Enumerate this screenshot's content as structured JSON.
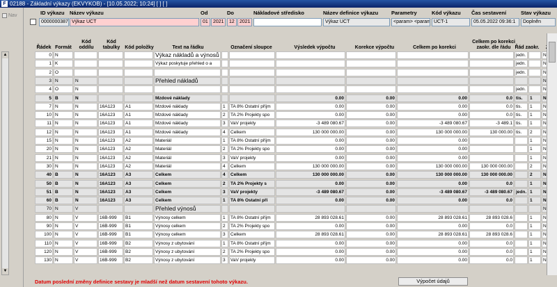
{
  "window": {
    "title": "02188 - Základní výkazy (EKVYKOB) - [10.05.2022; 10:24]  [ ]  [ ]"
  },
  "sidebar": {
    "nav_label": "Nav"
  },
  "header": {
    "labels": {
      "id": "ID výkazu",
      "name": "Název výkazu",
      "from": "Od",
      "to": "Do",
      "cost_center": "Nákladové středisko",
      "definition": "Název definice výkazu",
      "params": "Parametry",
      "code": "Kód výkazu",
      "created": "Čas sestavení",
      "state": "Stav výkazu"
    },
    "values": {
      "id": "0000000387",
      "name": "Výkaz UCT",
      "from_month": "01",
      "from_year": "2021",
      "to_month": "12",
      "to_year": "2021",
      "cost_center": "",
      "definition": "Výkaz UCT",
      "params": "<param>  <param",
      "code": "UCT-1",
      "created": "05.05.2022 09:36:1",
      "state": "Doplněn"
    }
  },
  "columns": {
    "row": "Řádek",
    "format": "Formát",
    "section": "Kód oddílu",
    "table": "Kód tabulky",
    "item": "Kód položky",
    "text": "Text na řádku",
    "col": "Označení sloupce",
    "result": "Výsledek výpočtu",
    "correction": "Korekce výpočtu",
    "total": "Celkem po korekci",
    "rounded": "Celkem po korekci zaokr. dle řádu",
    "order": "Řád zaokr.",
    "z": "Z"
  },
  "rows": [
    {
      "r": "0",
      "f": "N",
      "s": "",
      "t": "",
      "p": "",
      "text": "Výkaz nákladů a výnosů",
      "n": "",
      "col": "",
      "res": "",
      "cor": "",
      "tot": "",
      "rnd": "",
      "ord": "jedn.",
      "oz": "",
      "z": "N",
      "big": true
    },
    {
      "r": "1",
      "f": "K",
      "s": "",
      "t": "",
      "p": "",
      "text": "Výkaz poskytuje přehled o a",
      "n": "",
      "col": "",
      "res": "",
      "cor": "",
      "tot": "",
      "rnd": "",
      "ord": "jedn.",
      "oz": "",
      "z": "N"
    },
    {
      "r": "2",
      "f": "O",
      "s": "",
      "t": "",
      "p": "",
      "text": "",
      "n": "",
      "col": "",
      "res": "",
      "cor": "",
      "tot": "",
      "rnd": "",
      "ord": "jedn.",
      "oz": "",
      "z": "N"
    },
    {
      "r": "3",
      "f": "N",
      "s": "N",
      "t": "",
      "p": "",
      "text": "Přehled nákladů",
      "n": "",
      "col": "",
      "res": "",
      "cor": "",
      "tot": "",
      "rnd": "",
      "ord": "",
      "oz": "",
      "z": "N",
      "big": true,
      "gray": true
    },
    {
      "r": "4",
      "f": "O",
      "s": "N",
      "t": "",
      "p": "",
      "text": "",
      "n": "",
      "col": "",
      "res": "",
      "cor": "",
      "tot": "",
      "rnd": "",
      "ord": "jedn.",
      "oz": "",
      "z": "N"
    },
    {
      "r": "5",
      "f": "B",
      "s": "N",
      "t": "",
      "p": "",
      "text": "Mzdové náklady",
      "n": "",
      "col": "",
      "res": "0.00",
      "cor": "0.00",
      "tot": "0.00",
      "rnd": "0.0",
      "ord": "tis.",
      "oz": "1",
      "z": "N",
      "bold": true,
      "gray": true
    },
    {
      "r": "7",
      "f": "N",
      "s": "N",
      "t": "16A123",
      "p": "A1",
      "text": "Mzdové náklady",
      "n": "1",
      "col": "TA 8% Ostatní příjm",
      "res": "0.00",
      "cor": "0.00",
      "tot": "0.00",
      "rnd": "0.0",
      "ord": "tis.",
      "oz": "1",
      "z": "N"
    },
    {
      "r": "10",
      "f": "N",
      "s": "N",
      "t": "16A123",
      "p": "A1",
      "text": "Mzdové náklady",
      "n": "2",
      "col": "TA 2% Projekty spo",
      "res": "0.00",
      "cor": "0.00",
      "tot": "0.00",
      "rnd": "0.0",
      "ord": "tis.",
      "oz": "1",
      "z": "N"
    },
    {
      "r": "11",
      "f": "N",
      "s": "N",
      "t": "16A123",
      "p": "A1",
      "text": "Mzdové náklady",
      "n": "3",
      "col": "VaV projekty",
      "res": "-3 489 080.67",
      "cor": "0.00",
      "tot": "-3 489 080.67",
      "rnd": "-3 489.1",
      "ord": "tis.",
      "oz": "1",
      "z": "N"
    },
    {
      "r": "12",
      "f": "N",
      "s": "N",
      "t": "16A123",
      "p": "A1",
      "text": "Mzdové náklady",
      "n": "4",
      "col": "Celkem",
      "res": "130 000 000.00",
      "cor": "0.00",
      "tot": "130 000 000.00",
      "rnd": "130 000.00",
      "ord": "tis.",
      "oz": "2",
      "z": "N"
    },
    {
      "r": "15",
      "f": "N",
      "s": "N",
      "t": "16A123",
      "p": "A2",
      "text": "Materiál",
      "n": "1",
      "col": "TA 8% Ostatní příjm",
      "res": "0.00",
      "cor": "0.00",
      "tot": "0.00",
      "rnd": "",
      "ord": "",
      "oz": "1",
      "z": "N"
    },
    {
      "r": "20",
      "f": "N",
      "s": "N",
      "t": "16A123",
      "p": "A2",
      "text": "Materiál",
      "n": "2",
      "col": "TA 2% Projekty spo",
      "res": "0.00",
      "cor": "0.00",
      "tot": "0.00",
      "rnd": "",
      "ord": "",
      "oz": "1",
      "z": "N"
    },
    {
      "r": "21",
      "f": "N",
      "s": "N",
      "t": "16A123",
      "p": "A2",
      "text": "Materiál",
      "n": "3",
      "col": "VaV projekty",
      "res": "0.00",
      "cor": "0.00",
      "tot": "0.00",
      "rnd": "",
      "ord": "",
      "oz": "1",
      "z": "N"
    },
    {
      "r": "30",
      "f": "N",
      "s": "N",
      "t": "16A123",
      "p": "A2",
      "text": "Materiál",
      "n": "4",
      "col": "Celkem",
      "res": "130 000 000.00",
      "cor": "0.00",
      "tot": "130 000 000.00",
      "rnd": "130 000 000.00",
      "ord": "",
      "oz": "2",
      "z": "N"
    },
    {
      "r": "40",
      "f": "B",
      "s": "N",
      "t": "16A123",
      "p": "A3",
      "text": "Celkem",
      "n": "4",
      "col": "Celkem",
      "res": "130 000 000.00",
      "cor": "0.00",
      "tot": "130 000 000.00",
      "rnd": "130 000 000.00",
      "ord": "",
      "oz": "2",
      "z": "N",
      "bold": true,
      "gray": true
    },
    {
      "r": "50",
      "f": "B",
      "s": "N",
      "t": "16A123",
      "p": "A3",
      "text": "Celkem",
      "n": "2",
      "col": "TA 2% Projekty s",
      "res": "0.00",
      "cor": "0.00",
      "tot": "0.00",
      "rnd": "0.0",
      "ord": "",
      "oz": "1",
      "z": "N",
      "bold": true,
      "gray": true
    },
    {
      "r": "51",
      "f": "B",
      "s": "N",
      "t": "16A123",
      "p": "A3",
      "text": "Celkem",
      "n": "3",
      "col": "VaV projekty",
      "res": "-3 489 080.67",
      "cor": "0.00",
      "tot": "-3 489 080.67",
      "rnd": "-3 489 080.67",
      "ord": "jedn.",
      "oz": "1",
      "z": "N",
      "bold": true,
      "gray": true
    },
    {
      "r": "60",
      "f": "B",
      "s": "N",
      "t": "16A123",
      "p": "A3",
      "text": "Celkem",
      "n": "1",
      "col": "TA 8% Ostatní pří",
      "res": "0.00",
      "cor": "0.00",
      "tot": "0.00",
      "rnd": "0.0",
      "ord": "",
      "oz": "1",
      "z": "N",
      "bold": true,
      "gray": true
    },
    {
      "r": "70",
      "f": "N",
      "s": "V",
      "t": "",
      "p": "",
      "text": "Přehled výnosů",
      "n": "",
      "col": "",
      "res": "",
      "cor": "",
      "tot": "",
      "rnd": "",
      "ord": "",
      "oz": "",
      "z": "N",
      "big": true,
      "gray": true
    },
    {
      "r": "80",
      "f": "N",
      "s": "V",
      "t": "16B-999",
      "p": "B1",
      "text": "Výnosy celkem",
      "n": "1",
      "col": "TA 8% Ostatní příjm",
      "res": "28 893 028.61",
      "cor": "0.00",
      "tot": "28 893 028.61",
      "rnd": "28 893 028.6",
      "ord": "",
      "oz": "1",
      "z": "N"
    },
    {
      "r": "90",
      "f": "N",
      "s": "V",
      "t": "16B-999",
      "p": "B1",
      "text": "Výnosy celkem",
      "n": "2",
      "col": "TA 2% Projekty spo",
      "res": "0.00",
      "cor": "0.00",
      "tot": "0.00",
      "rnd": "0.0",
      "ord": "",
      "oz": "1",
      "z": "N"
    },
    {
      "r": "100",
      "f": "N",
      "s": "V",
      "t": "16B-999",
      "p": "B1",
      "text": "Výnosy celkem",
      "n": "3",
      "col": "Celkem",
      "res": "28 893 028.61",
      "cor": "0.00",
      "tot": "28 893 028.61",
      "rnd": "28 893 028.6",
      "ord": "",
      "oz": "1",
      "z": "N"
    },
    {
      "r": "110",
      "f": "N",
      "s": "V",
      "t": "16B-999",
      "p": "B2",
      "text": "Výnosy z ubytování",
      "n": "1",
      "col": "TA 8% Ostatní příjm",
      "res": "0.00",
      "cor": "0.00",
      "tot": "0.00",
      "rnd": "0.0",
      "ord": "",
      "oz": "1",
      "z": "N"
    },
    {
      "r": "120",
      "f": "N",
      "s": "V",
      "t": "16B-999",
      "p": "B2",
      "text": "Výnosy z ubytování",
      "n": "2",
      "col": "TA 2% Projekty spo",
      "res": "0.00",
      "cor": "0.00",
      "tot": "0.00",
      "rnd": "0.0",
      "ord": "",
      "oz": "1",
      "z": "N"
    },
    {
      "r": "130",
      "f": "N",
      "s": "V",
      "t": "16B-999",
      "p": "B2",
      "text": "Výnosy z ubytování",
      "n": "3",
      "col": "VaV projekty",
      "res": "0.00",
      "cor": "0.00",
      "tot": "0.00",
      "rnd": "0.0",
      "ord": "",
      "oz": "1",
      "z": "N"
    }
  ],
  "footer": {
    "warning": "Datum poslední změny definice sestavy je mladší než datum sestavení tohoto výkazu.",
    "calc_button": "Výpočet údajů"
  },
  "colors": {
    "warning": "#e00000",
    "titlebar": "#0a246a",
    "pink_field": "#ffd0d0"
  }
}
